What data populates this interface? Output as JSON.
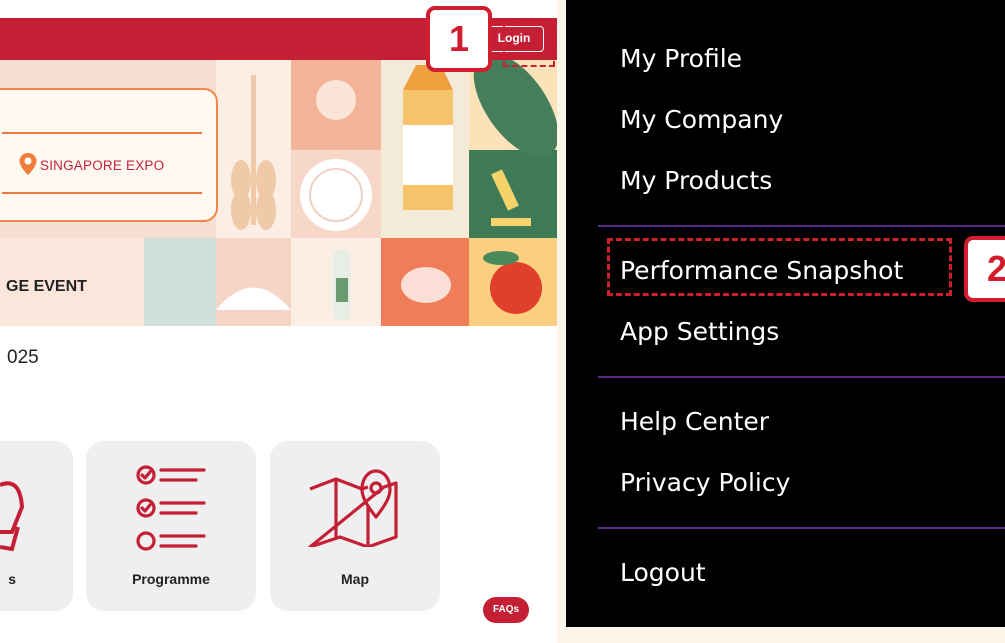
{
  "left": {
    "header": {
      "login_label": "Login"
    },
    "banner": {
      "venue": "SINGAPORE EXPO",
      "event_text": "GE EVENT"
    },
    "year_text": "025",
    "cards": [
      {
        "label": "s",
        "icon": "person-icon"
      },
      {
        "label": "Programme",
        "icon": "checklist-icon"
      },
      {
        "label": "Map",
        "icon": "map-icon"
      }
    ],
    "faqs_label": "FAQs"
  },
  "menu": {
    "items": [
      "My Profile",
      "My Company",
      "My Products",
      "Performance Snapshot",
      "App Settings",
      "Help Center",
      "Privacy Policy",
      "Logout"
    ]
  },
  "callouts": {
    "one": "1",
    "two": "2"
  },
  "colors": {
    "brand_red": "#c41f35",
    "callout_red": "#d11e2f",
    "menu_bg": "#000000",
    "menu_divider": "#5a2a86",
    "page_bg": "#fbf4e9"
  }
}
